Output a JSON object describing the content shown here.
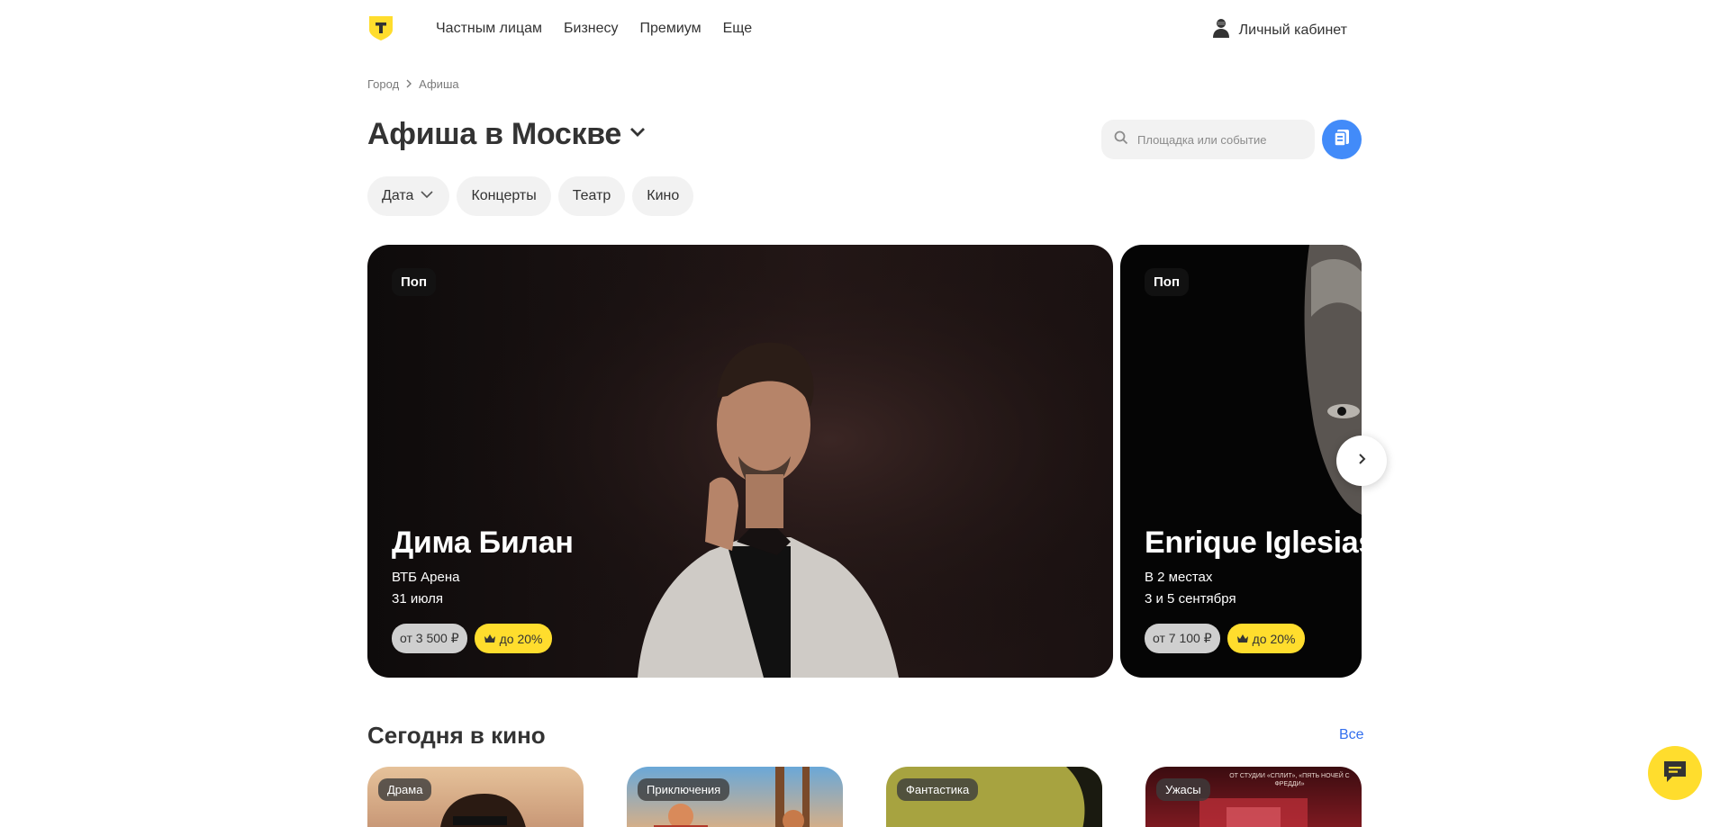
{
  "header": {
    "nav": [
      "Частным лицам",
      "Бизнесу",
      "Премиум",
      "Еще"
    ],
    "account_label": "Личный кабинет"
  },
  "breadcrumb": [
    "Город",
    "Афиша"
  ],
  "page_title": "Афиша в Москве",
  "search": {
    "placeholder": "Площадка или событие",
    "value": ""
  },
  "filters": [
    "Дата",
    "Концерты",
    "Театр",
    "Кино"
  ],
  "events": [
    {
      "tag": "Поп",
      "title": "Дима Билан",
      "venue": "ВТБ Арена",
      "date": "31 июля",
      "price": "от 3 500 ₽",
      "discount": "до 20%"
    },
    {
      "tag": "Поп",
      "title": "Enrique Iglesias",
      "venue": "В 2 местах",
      "date": "3 и 5 сентября",
      "price": "от 7 100 ₽",
      "discount": "до 20%"
    }
  ],
  "cinema": {
    "title": "Сегодня в кино",
    "all_label": "Все",
    "movies": [
      {
        "tag": "Драма"
      },
      {
        "tag": "Приключения"
      },
      {
        "tag": "Фантастика"
      },
      {
        "tag": "Ужасы",
        "poster_text": "ОТ СТУДИИ «СПЛИТ», «ПЯТЬ НОЧЕЙ С ФРЕДДИ»"
      }
    ]
  },
  "colors": {
    "brand_yellow": "#ffdd2d",
    "accent_blue": "#428bf9",
    "link_blue": "#336fee"
  },
  "icons": [
    "logo-shield-icon",
    "user-icon",
    "chevron-right-icon",
    "chevron-down-icon",
    "search-icon",
    "tickets-icon",
    "crown-icon",
    "chat-icon"
  ]
}
